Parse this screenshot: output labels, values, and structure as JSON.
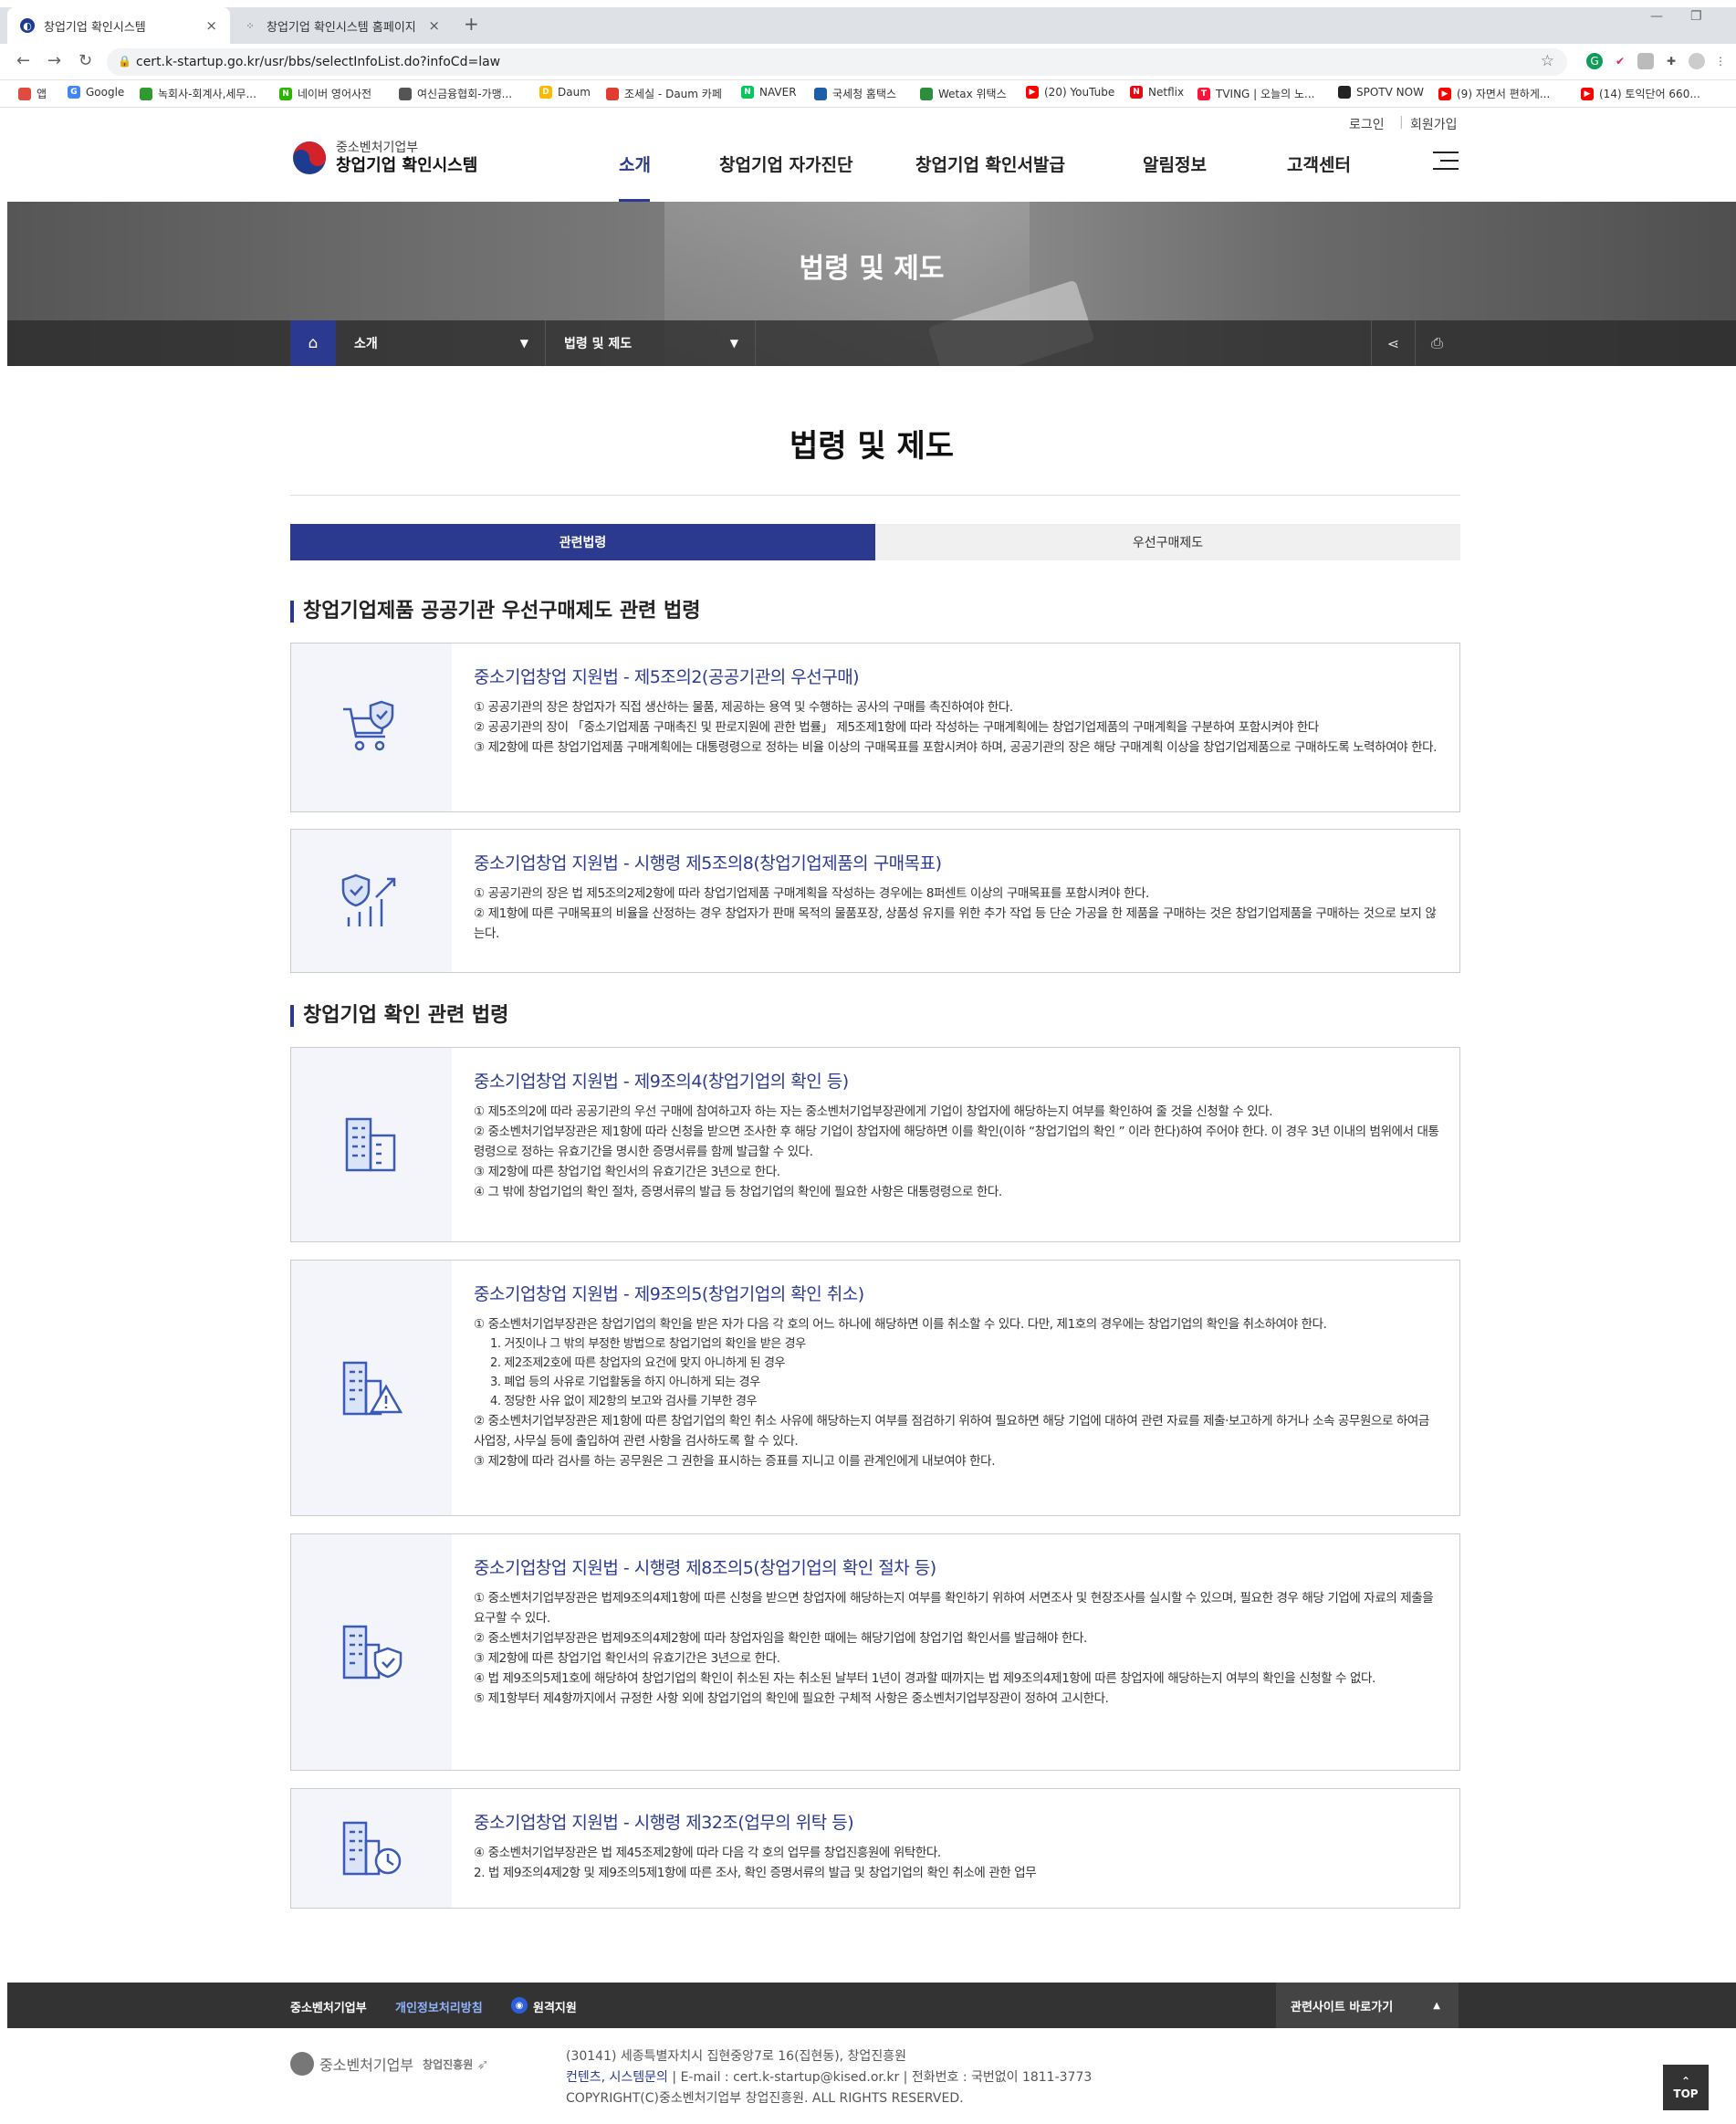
{
  "browser": {
    "tabs": [
      {
        "title": "창업기업 확인시스템",
        "close": "×"
      },
      {
        "title": "창업기업 확인시스템 홈페이지",
        "close": "×"
      }
    ],
    "new_tab": "+",
    "url": "cert.k-startup.go.kr/usr/bbs/selectInfoList.do?infoCd=law",
    "bookmarks": [
      {
        "label": "앱",
        "color": "#e04a3f"
      },
      {
        "label": "Google",
        "color": "#4285f4"
      },
      {
        "label": "녹회사-회계사,세무...",
        "color": "#2e9b2e"
      },
      {
        "label": "네이버 영어사전",
        "color": "#2db400"
      },
      {
        "label": "여신금융협회-가맹...",
        "color": "#555555"
      },
      {
        "label": "Daum",
        "color": "#ffb800"
      },
      {
        "label": "조세실 - Daum 카페",
        "color": "#e03c31"
      },
      {
        "label": "NAVER",
        "color": "#03c75a"
      },
      {
        "label": "국세청 홈택스",
        "color": "#1d5ea8"
      },
      {
        "label": "Wetax 위택스",
        "color": "#2c8d3c"
      },
      {
        "label": "(20) YouTube",
        "color": "#ff0000"
      },
      {
        "label": "Netflix",
        "color": "#e50914"
      },
      {
        "label": "TVING | 오늘의 노...",
        "color": "#ff153c"
      },
      {
        "label": "SPOTV NOW",
        "color": "#222222"
      },
      {
        "label": "(9) 자면서 편하게...",
        "color": "#ff0000"
      },
      {
        "label": "(14) 토익단어 660...",
        "color": "#ff0000"
      }
    ]
  },
  "site": {
    "util": {
      "login": "로그인",
      "join": "회원가입"
    },
    "logo": {
      "ministry": "중소벤처기업부",
      "system": "창업기업 확인시스템"
    },
    "gnb": [
      "소개",
      "창업기업 자가진단",
      "창업기업 확인서발급",
      "알림정보",
      "고객센터"
    ],
    "visual_title": "법령 및 제도",
    "location": {
      "depth1": "소개",
      "depth2": "법령 및 제도"
    },
    "page_title": "법령 및 제도",
    "tabs": [
      "관련법령",
      "우선구매제도"
    ],
    "sections": [
      {
        "title": "창업기업제품 공공기관 우선구매제도 관련 법령",
        "cards": [
          {
            "icon": "cart-shield-icon",
            "title": "중소기업창업 지원법 - 제5조의2(공공기관의 우선구매)",
            "lines": [
              {
                "text": "① 공공기관의 장은 창업자가 직접 생산하는 물품, 제공하는 용역 및 수행하는 공사의 구매를 촉진하여야 한다.",
                "sub": false
              },
              {
                "text": "② 공공기관의 장이 「중소기업제품 구매촉진 및 판로지원에 관한 법률」 제5조제1항에 따라 작성하는 구매계획에는 창업기업제품의 구매계획을 구분하여 포함시켜야 한다",
                "sub": false
              },
              {
                "text": "③ 제2항에 따른 창업기업제품 구매계획에는 대통령령으로 정하는 비율 이상의 구매목표를 포함시켜야 하며, 공공기관의 장은 해당 구매계획 이상을 창업기업제품으로 구매하도록 노력하여야 한다.",
                "sub": false
              }
            ]
          },
          {
            "icon": "shield-chart-icon",
            "title": "중소기업창업 지원법 - 시행령 제5조의8(창업기업제품의 구매목표)",
            "lines": [
              {
                "text": "① 공공기관의 장은 법 제5조의2제2항에 따라 창업기업제품 구매계획을 작성하는 경우에는 8퍼센트 이상의 구매목표를 포함시켜야 한다.",
                "sub": false
              },
              {
                "text": "② 제1항에 따른 구매목표의 비율을 산정하는 경우 창업자가 판매 목적의 물품포장, 상품성 유지를 위한 추가 작업 등 단순 가공을 한 제품을 구매하는 것은 창업기업제품을 구매하는 것으로 보지 않는다.",
                "sub": false
              }
            ]
          }
        ]
      },
      {
        "title": "창업기업 확인 관련 법령",
        "cards": [
          {
            "icon": "building-icon",
            "title": "중소기업창업 지원법 - 제9조의4(창업기업의 확인 등)",
            "lines": [
              {
                "text": "① 제5조의2에 따라 공공기관의 우선 구매에 참여하고자 하는 자는 중소벤처기업부장관에게 기업이 창업자에 해당하는지 여부를 확인하여 줄 것을 신청할 수 있다.",
                "sub": false
              },
              {
                "text": "② 중소벤처기업부장관은 제1항에 따라 신청을 받으면 조사한 후 해당 기업이 창업자에 해당하면 이를 확인(이하 “창업기업의 확인 ” 이라 한다)하여 주어야 한다. 이 경우 3년 이내의 범위에서 대통령령으로 정하는 유효기간을 명시한 증명서류를 함께 발급할 수 있다.",
                "sub": false
              },
              {
                "text": "③ 제2항에 따른 창업기업 확인서의 유효기간은 3년으로 한다.",
                "sub": false
              },
              {
                "text": "④ 그 밖에 창업기업의 확인 절차, 증명서류의 발급 등 창업기업의 확인에 필요한 사항은 대통령령으로 한다.",
                "sub": false
              }
            ]
          },
          {
            "icon": "building-warning-icon",
            "title": "중소기업창업 지원법 - 제9조의5(창업기업의 확인 취소)",
            "lines": [
              {
                "text": "① 중소벤처기업부장관은 창업기업의 확인을 받은 자가 다음 각 호의 어느 하나에 해당하면 이를 취소할 수 있다. 다만, 제1호의 경우에는 창업기업의 확인을 취소하여야 한다.",
                "sub": false
              },
              {
                "text": "1. 거짓이나 그 밖의 부정한 방법으로 창업기업의 확인을 받은 경우",
                "sub": true
              },
              {
                "text": "2. 제2조제2호에 따른 창업자의 요건에 맞지 아니하게 된 경우",
                "sub": true
              },
              {
                "text": "3. 폐업 등의 사유로 기업활동을 하지 아니하게 되는 경우",
                "sub": true
              },
              {
                "text": "4. 정당한 사유 없이 제2항의 보고와 검사를 기부한 경우",
                "sub": true
              },
              {
                "text": "② 중소벤처기업부장관은 제1항에 따른 창업기업의 확인 취소 사유에 해당하는지 여부를 점검하기 위하여 필요하면 해당 기업에 대하여 관련 자료를 제출·보고하게 하거나 소속 공무원으로 하여금 사업장, 사무실 등에 출입하여 관련 사항을 검사하도록 할 수 있다.",
                "sub": false
              },
              {
                "text": "③ 제2항에 따라 검사를 하는 공무원은 그 권한을 표시하는 증표를 지니고 이를 관계인에게 내보여야 한다.",
                "sub": false
              }
            ]
          },
          {
            "icon": "building-shield-icon",
            "title": "중소기업창업 지원법 - 시행령 제8조의5(창업기업의 확인 절차 등)",
            "lines": [
              {
                "text": "① 중소벤처기업부장관은 법제9조의4제1항에 따른 신청을 받으면 창업자에 해당하는지 여부를 확인하기 위하여 서면조사 및 현장조사를 실시할 수 있으며, 필요한 경우 해당 기업에 자료의 제출을 요구할 수 있다.",
                "sub": false
              },
              {
                "text": "② 중소벤처기업부장관은 법제9조의4제2항에 따라 창업자임을 확인한 때에는 해당기업에 창업기업 확인서를 발급해야 한다.",
                "sub": false
              },
              {
                "text": "③ 제2항에 따른 창업기업 확인서의 유효기간은 3년으로 한다.",
                "sub": false
              },
              {
                "text": "④ 법 제9조의5제1호에 해당하여 창업기업의 확인이 취소된 자는 취소된 날부터 1년이 경과할 때까지는 법 제9조의4제1항에 따른 창업자에 해당하는지 여부의 확인을 신청할 수 없다.",
                "sub": false
              },
              {
                "text": "⑤ 제1항부터 제4항까지에서 규정한 사항 외에 창업기업의 확인에 필요한 구체적 사항은 중소벤처기업부장관이 정하여 고시한다.",
                "sub": false
              }
            ]
          },
          {
            "icon": "building-clock-icon",
            "title": "중소기업창업 지원법 - 시행령 제32조(업무의 위탁 등)",
            "lines": [
              {
                "text": "④ 중소벤처기업부장관은 법 제45조제2항에 따라 다음 각 호의 업무를 창업진흥원에 위탁한다.",
                "sub": false
              },
              {
                "text": "2. 법 제9조의4제2항 및 제9조의5제1항에 따른 조사, 확인 증명서류의 발급 및 창업기업의 확인 취소에 관한 업무",
                "sub": false
              }
            ]
          }
        ]
      }
    ],
    "footer": {
      "links": [
        "중소벤처기업부",
        "개인정보처리방침",
        "원격지원"
      ],
      "related": "관련사이트 바로가기",
      "logo1": "중소벤처기업부",
      "logo2": "창업진흥원",
      "address": "(30141) 세종특별자치시 집현중앙7로 16(집현동), 창업진흥원",
      "contact_links": "컨텐츠, 시스템문의",
      "email": "E-mail : cert.k-startup@kised.or.kr",
      "phone": "전화번호 : 국번없이 1811-3773",
      "copyright": "COPYRIGHT(C)중소벤처기업부 창업진흥원. ALL RIGHTS RESERVED.",
      "top": "TOP"
    }
  }
}
